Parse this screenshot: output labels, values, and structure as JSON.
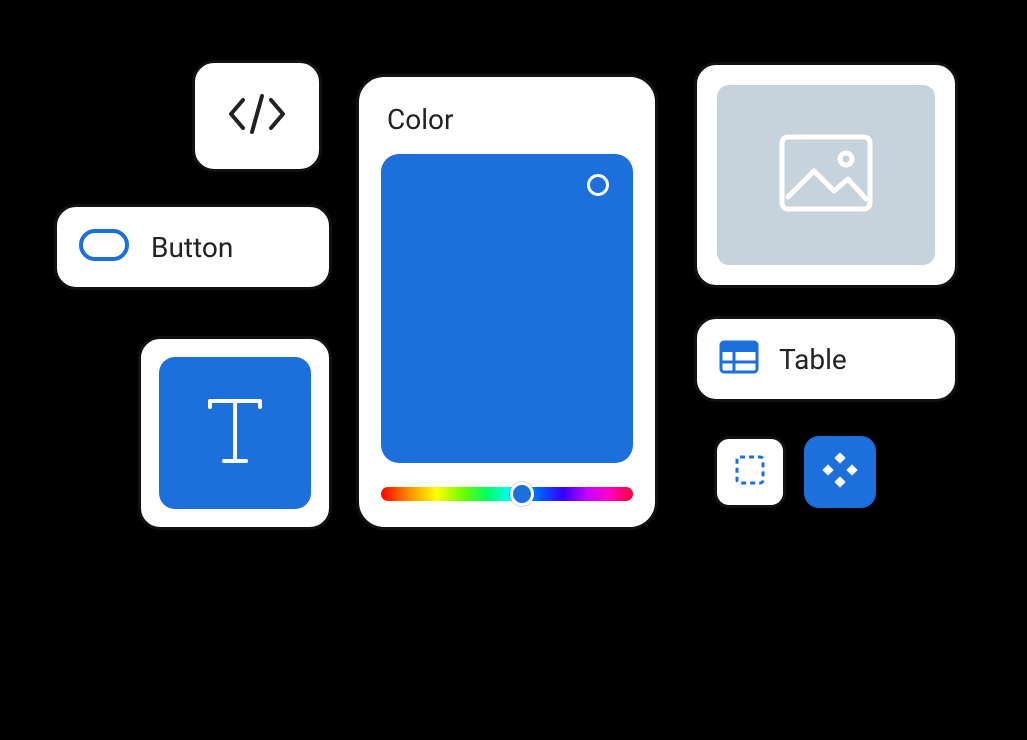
{
  "tiles": {
    "code": {
      "icon": "code-icon"
    },
    "button": {
      "label": "Button",
      "icon": "button-shape-icon"
    },
    "text": {
      "icon": "typography-icon"
    },
    "colorPicker": {
      "title": "Color",
      "swatchHex": "#1d6fdc",
      "hueThumbHex": "#1d6fdc"
    },
    "image": {
      "icon": "image-placeholder-icon"
    },
    "table": {
      "label": "Table",
      "icon": "table-icon"
    },
    "selection": {
      "icon": "selection-dashed-icon"
    },
    "component": {
      "icon": "component-diamond-icon"
    }
  }
}
